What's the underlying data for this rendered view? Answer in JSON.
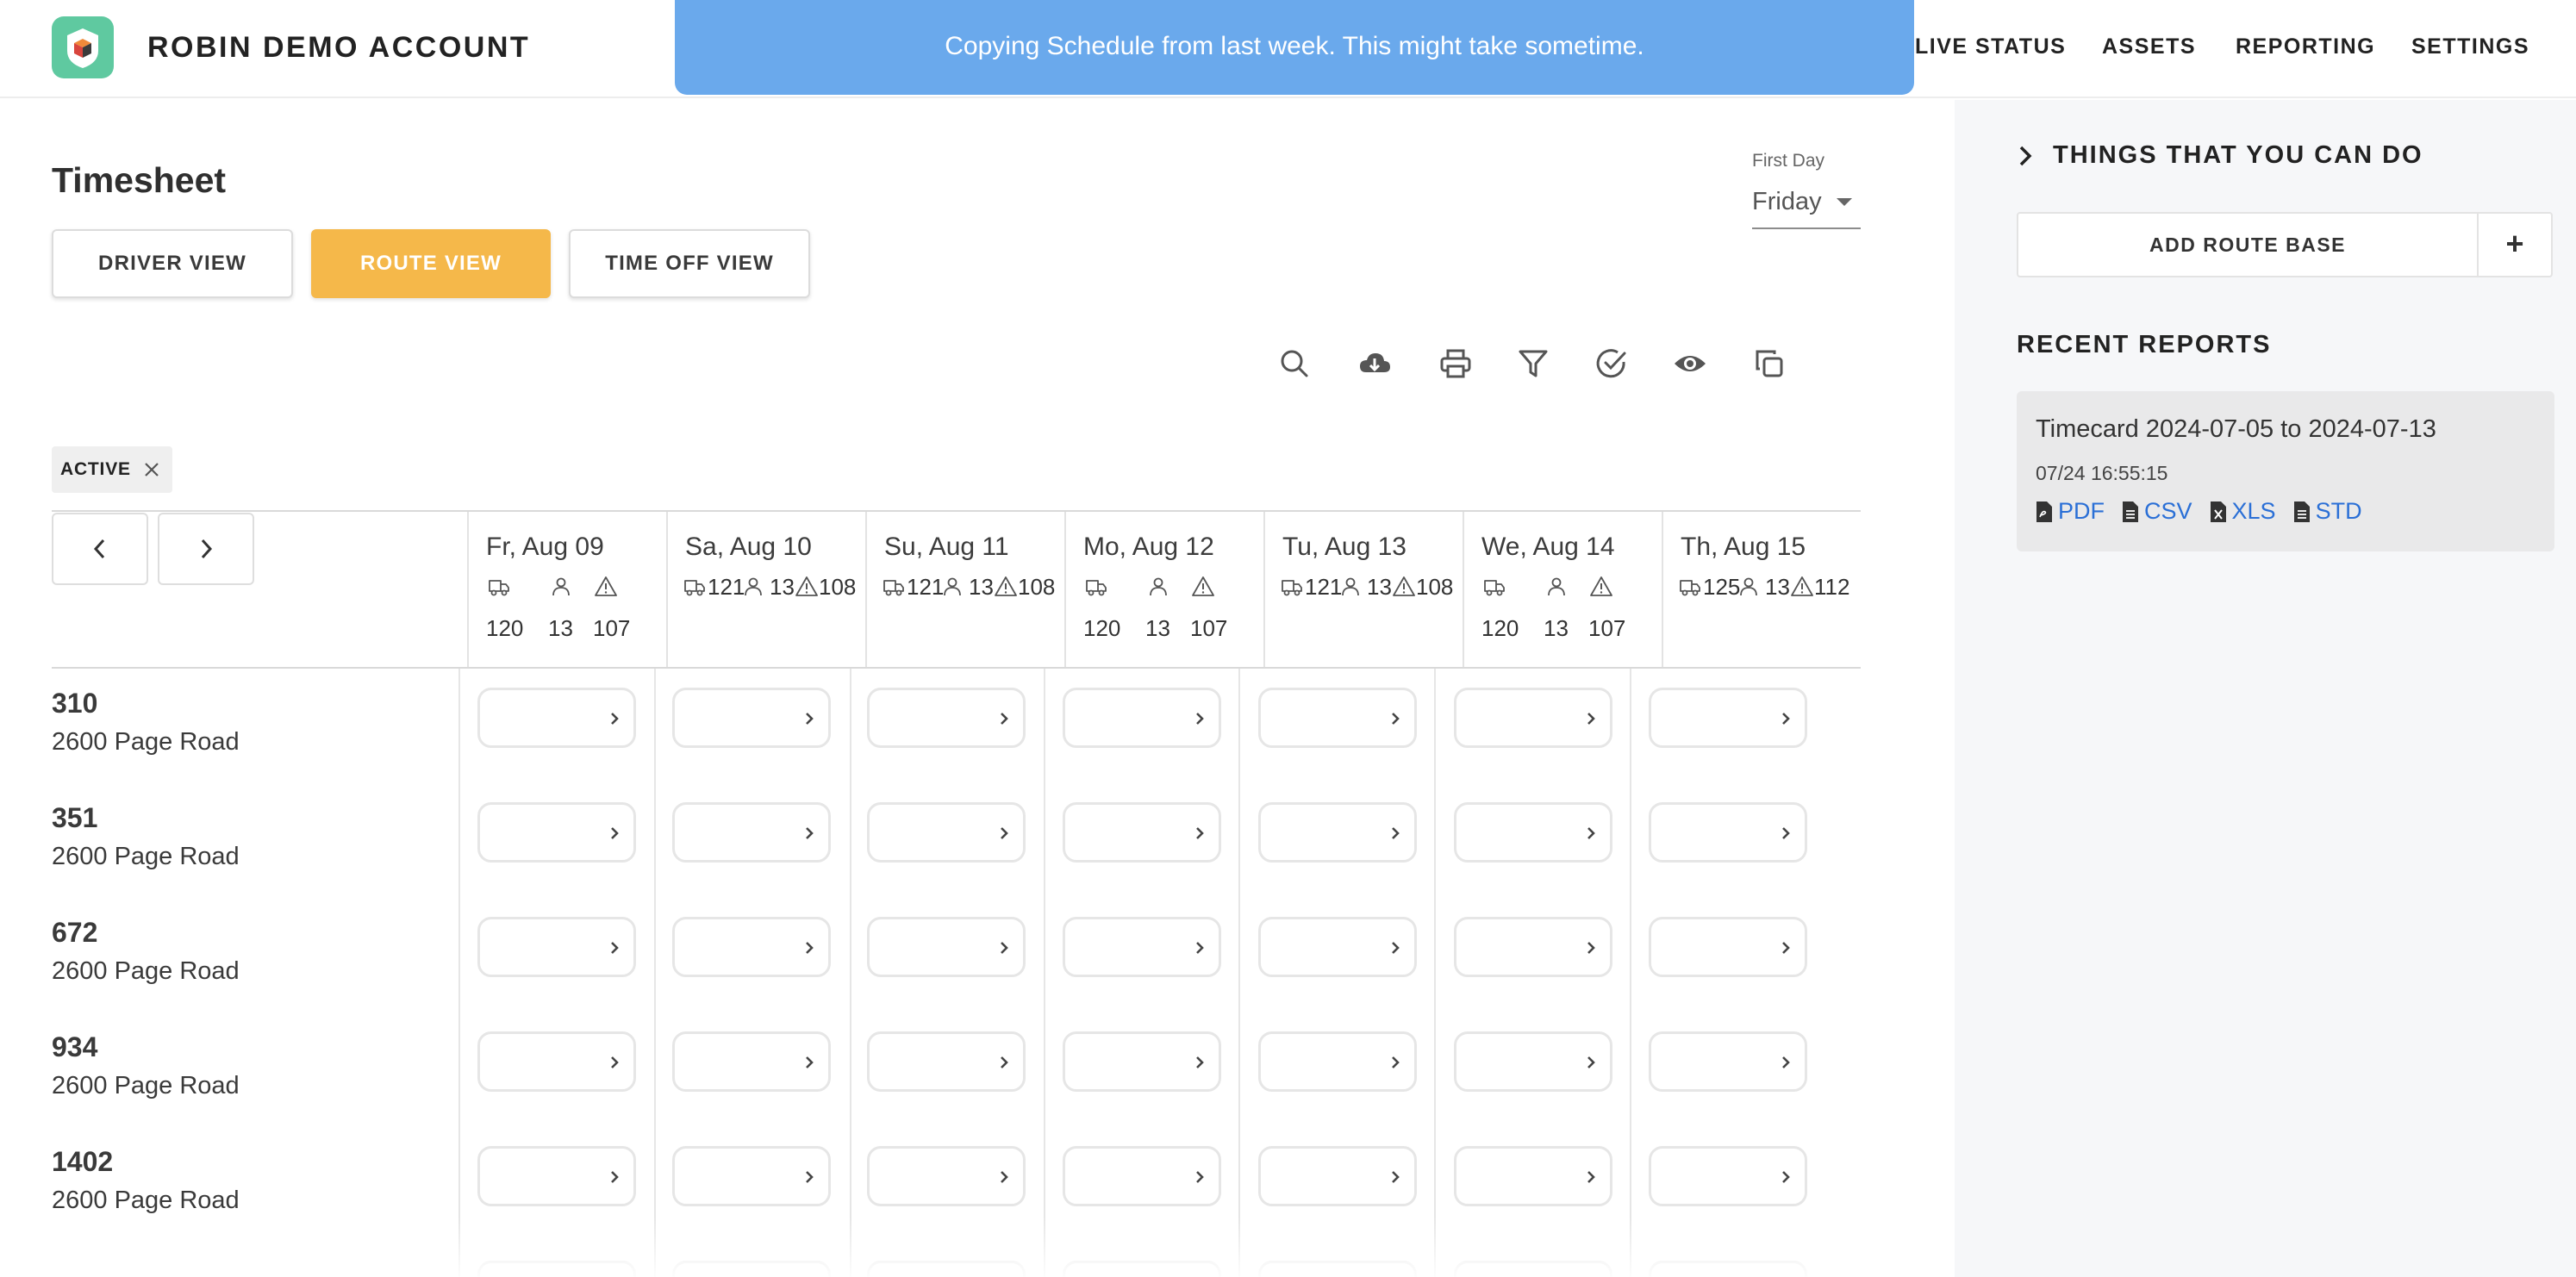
{
  "header": {
    "brand": "ROBIN DEMO ACCOUNT",
    "nav": [
      "LIVE STATUS",
      "ASSETS",
      "REPORTING",
      "SETTINGS"
    ],
    "toast": "Copying Schedule from last week. This might take sometime."
  },
  "main": {
    "title": "Timesheet",
    "views": [
      "DRIVER VIEW",
      "ROUTE VIEW",
      "TIME OFF VIEW"
    ],
    "active_view": "ROUTE VIEW",
    "first_day": {
      "label": "First Day",
      "value": "Friday"
    },
    "tools": [
      "search-icon",
      "cloud-download-icon",
      "print-icon",
      "filter-icon",
      "check-circle-icon",
      "eye-icon",
      "copy-icon"
    ],
    "filter_chip": "ACTIVE",
    "days": [
      {
        "name": "Fr, Aug 09",
        "trucks": "120",
        "drivers": "13",
        "alerts": "107"
      },
      {
        "name": "Sa, Aug 10",
        "trucks": "121",
        "drivers": "13",
        "alerts": "108"
      },
      {
        "name": "Su, Aug 11",
        "trucks": "121",
        "drivers": "13",
        "alerts": "108"
      },
      {
        "name": "Mo, Aug 12",
        "trucks": "120",
        "drivers": "13",
        "alerts": "107"
      },
      {
        "name": "Tu, Aug 13",
        "trucks": "121",
        "drivers": "13",
        "alerts": "108"
      },
      {
        "name": "We, Aug 14",
        "trucks": "120",
        "drivers": "13",
        "alerts": "107"
      },
      {
        "name": "Th, Aug 15",
        "trucks": "125",
        "drivers": "13",
        "alerts": "112"
      }
    ],
    "routes": [
      {
        "number": "310",
        "address": "2600 Page Road"
      },
      {
        "number": "351",
        "address": "2600 Page Road"
      },
      {
        "number": "672",
        "address": "2600 Page Road"
      },
      {
        "number": "934",
        "address": "2600 Page Road"
      },
      {
        "number": "1402",
        "address": "2600 Page Road"
      }
    ]
  },
  "sidebar": {
    "things_title": "THINGS THAT YOU CAN DO",
    "add_route_base": "ADD ROUTE BASE",
    "add_plus": "+",
    "recent_title": "RECENT REPORTS",
    "report": {
      "name": "Timecard 2024-07-05 to 2024-07-13",
      "date": "07/24 16:55:15",
      "links": [
        "PDF",
        "CSV",
        "XLS",
        "STD"
      ]
    }
  },
  "colors": {
    "accent": "#f5b84a",
    "toast": "#6aa9ec",
    "logo": "#5fc9a0",
    "link": "#2a6fd6"
  }
}
